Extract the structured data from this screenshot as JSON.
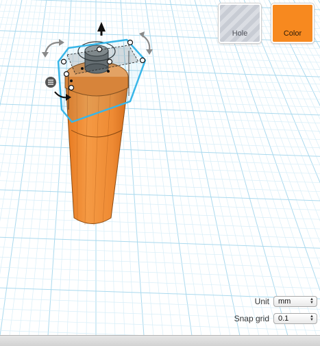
{
  "toolbar": {
    "hole_label": "Hole",
    "color_label": "Color",
    "color_value": "#f7891f"
  },
  "settings": {
    "unit_label": "Unit",
    "unit_value": "mm",
    "snap_label": "Snap grid",
    "snap_value": "0.1"
  },
  "colors": {
    "object": "#f0903a",
    "selection": "#38b6e8",
    "grid_minor": "#d7eef8",
    "grid_major": "#a9d9ee"
  },
  "icons": [
    "rotate-arrow-icon",
    "lift-arrow-icon",
    "align-menu-icon",
    "scale-handle-icon"
  ]
}
